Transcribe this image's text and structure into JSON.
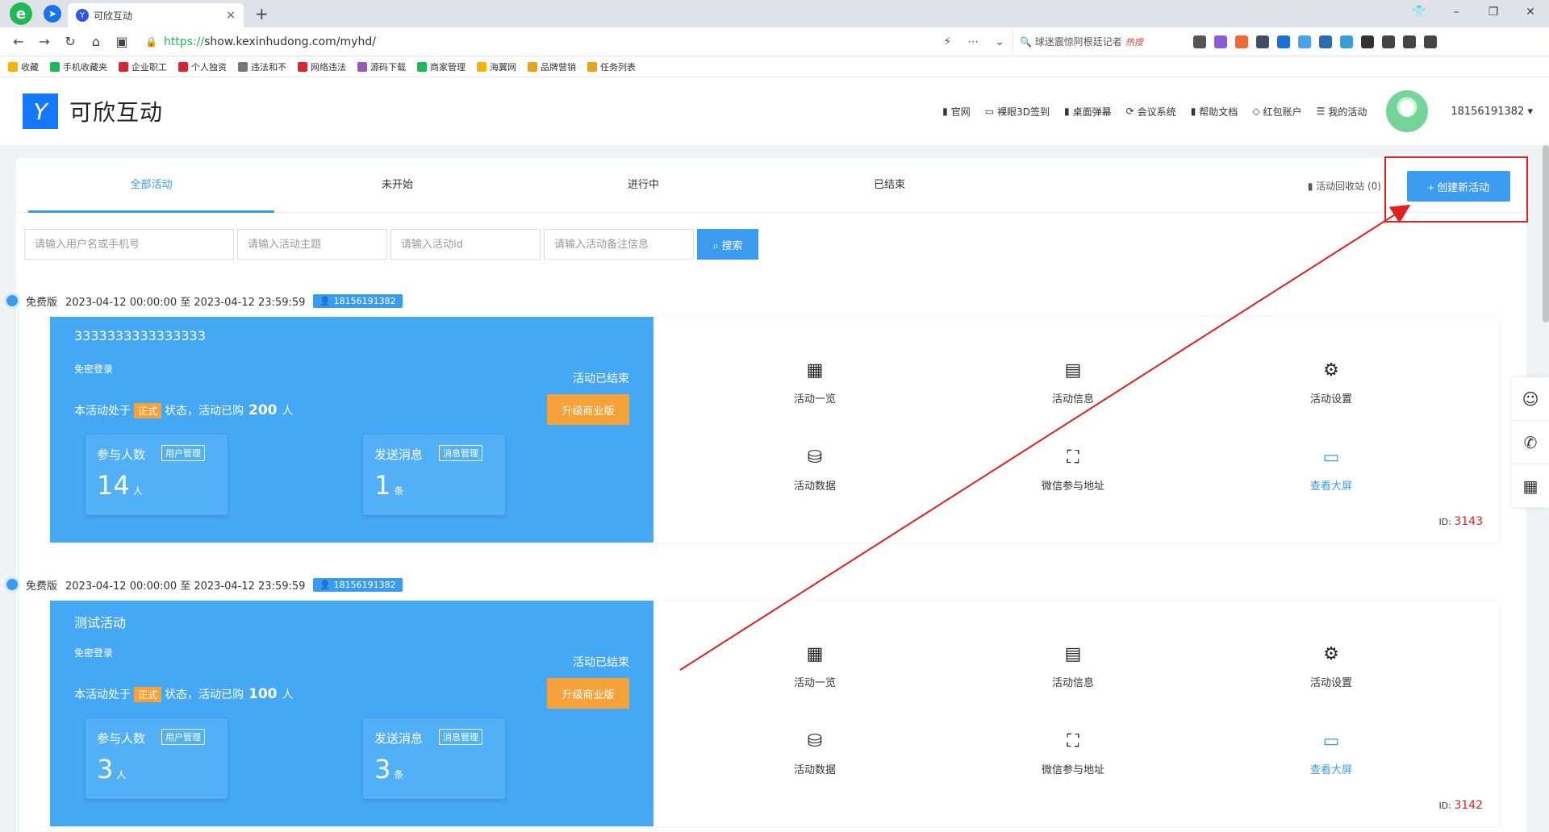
{
  "browser": {
    "tab_title": "可欣互动",
    "tab_close": "×",
    "tab_new": "+",
    "url_proto": "https://",
    "url_rest": "show.kexinhudong.com/myhd/",
    "search_hint": "球迷震惊阿根廷记者",
    "search_hot": "热搜",
    "bookmarks": [
      "收藏",
      "手机收藏夹",
      "企业职工",
      "个人独资",
      "违法和不",
      "网络违法",
      "源码下载",
      "商家管理",
      "海翼网",
      "品牌营销",
      "任务列表"
    ]
  },
  "header": {
    "brand": "可欣互动",
    "nav": [
      "官网",
      "裸眼3D签到",
      "桌面弹幕",
      "会议系统",
      "帮助文档",
      "红包账户",
      "我的活动"
    ],
    "user_phone": "18156191382"
  },
  "tabs": [
    "全部活动",
    "未开始",
    "进行中",
    "已结束"
  ],
  "recycle": "活动回收站 (0)",
  "create_button": "+ 创建新活动",
  "filters": {
    "user_placeholder": "请输入用户名或手机号",
    "topic_placeholder": "请输入活动主题",
    "id_placeholder": "请输入活动id",
    "note_placeholder": "请输入活动备注信息",
    "search_label": "搜索"
  },
  "activities": [
    {
      "edition": "免费版",
      "period": "2023-04-12 00:00:00 至 2023-04-12 23:59:59",
      "owner": "18156191382",
      "title": "3333333333333333",
      "login": "免密登录",
      "status_prefix": "本活动处于",
      "status_tag": "正式",
      "status_mid": "状态，活动已购",
      "purchased": "200",
      "status_suffix": "人",
      "ended": "活动已结束",
      "upgrade": "升级商业版",
      "participants_label": "参与人数",
      "participants_tag": "用户管理",
      "participants": "14",
      "participants_unit": "人",
      "messages_label": "发送消息",
      "messages_tag": "消息管理",
      "messages": "1",
      "messages_unit": "条",
      "ops": [
        "活动一览",
        "活动信息",
        "活动设置",
        "活动数据",
        "微信参与地址",
        "查看大屏"
      ],
      "id_label": "ID:",
      "id": "3143"
    },
    {
      "edition": "免费版",
      "period": "2023-04-12 00:00:00 至 2023-04-12 23:59:59",
      "owner": "18156191382",
      "title": "测试活动",
      "login": "免密登录",
      "status_prefix": "本活动处于",
      "status_tag": "正式",
      "status_mid": "状态，活动已购",
      "purchased": "100",
      "status_suffix": "人",
      "ended": "活动已结束",
      "upgrade": "升级商业版",
      "participants_label": "参与人数",
      "participants_tag": "用户管理",
      "participants": "3",
      "participants_unit": "人",
      "messages_label": "发送消息",
      "messages_tag": "消息管理",
      "messages": "3",
      "messages_unit": "条",
      "ops": [
        "活动一览",
        "活动信息",
        "活动设置",
        "活动数据",
        "微信参与地址",
        "查看大屏"
      ],
      "id_label": "ID:",
      "id": "3142"
    }
  ],
  "colors": {
    "primary": "#3a9bf0",
    "card": "#45a8f5",
    "accent": "#f7a239",
    "annotation": "#e02020"
  }
}
